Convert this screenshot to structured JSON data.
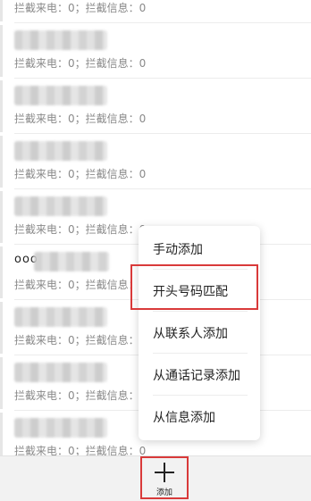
{
  "rows": [
    {
      "stats": "拦截来电：0；拦截信息：0",
      "prefix": ""
    },
    {
      "stats": "拦截来电：0；拦截信息：0",
      "prefix": ""
    },
    {
      "stats": "拦截来电：0；拦截信息：0",
      "prefix": ""
    },
    {
      "stats": "拦截来电：0；拦截信息：0",
      "prefix": ""
    },
    {
      "stats": "拦截来电：0；拦截信息：0",
      "prefix": ""
    },
    {
      "stats": "拦截来电：0；拦截信息：0",
      "prefix": "ooo"
    },
    {
      "stats": "拦截来电：0；拦截信息：0",
      "prefix": ""
    },
    {
      "stats": "拦截来电：0；拦截信息：0",
      "prefix": ""
    },
    {
      "stats": "拦截来电：0；拦截信息：0",
      "prefix": ""
    }
  ],
  "menu": {
    "items": [
      "手动添加",
      "开头号码匹配",
      "从联系人添加",
      "从通话记录添加",
      "从信息添加"
    ]
  },
  "bottom_bar": {
    "add_label": "添加"
  },
  "colors": {
    "highlight": "#d93a3a",
    "stats_text": "#8a8a8a",
    "bottom_bar_bg": "#f2f2f2"
  },
  "icons": {
    "add": "plus-icon"
  }
}
